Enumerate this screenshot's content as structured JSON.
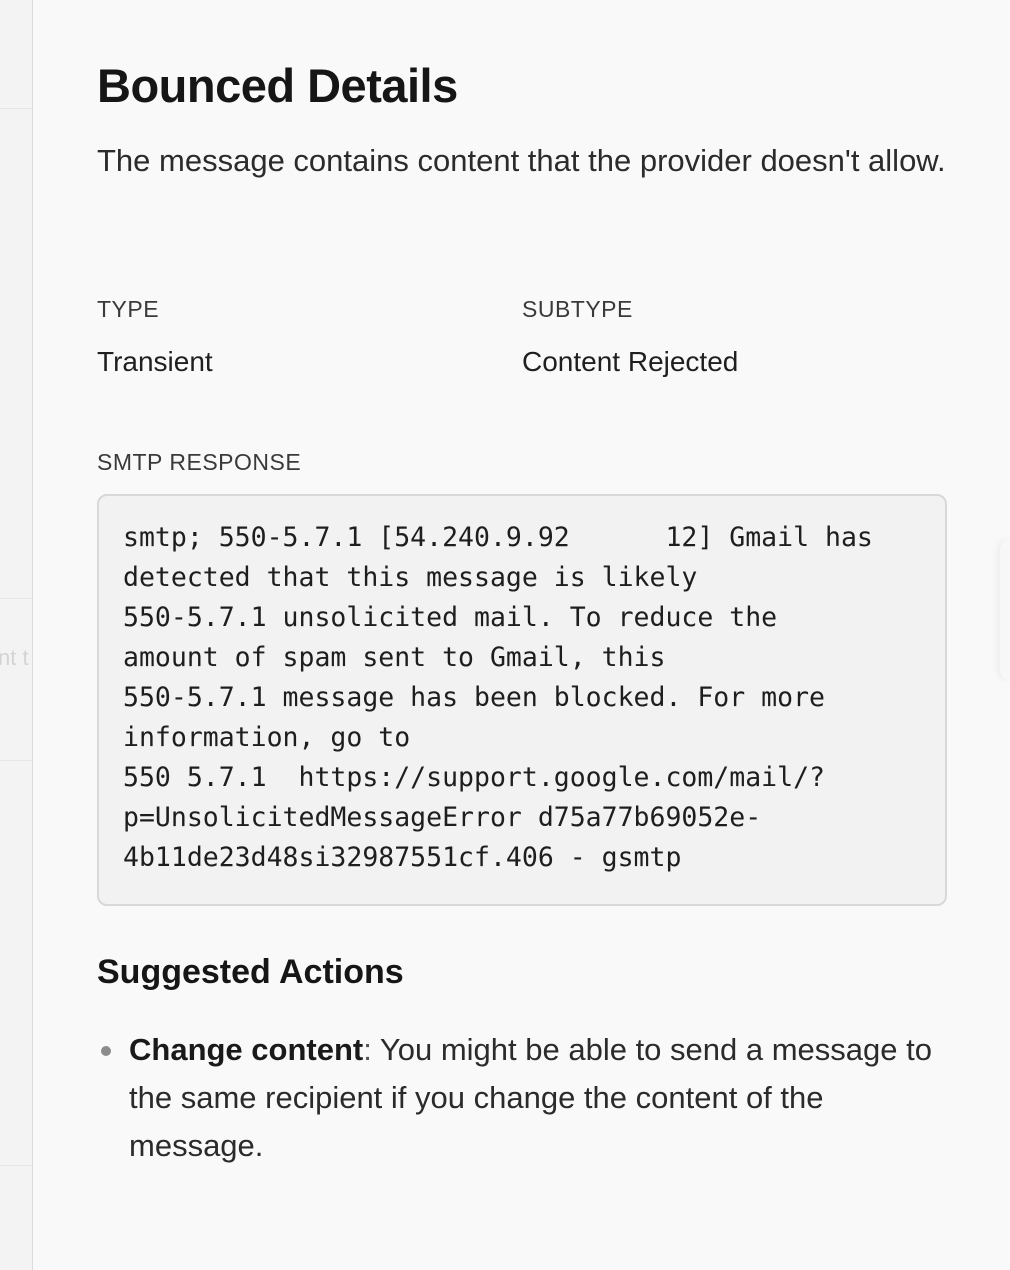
{
  "panel": {
    "title": "Bounced Details",
    "description": "The message contains content that the provider doesn't allow."
  },
  "fields": {
    "type_label": "TYPE",
    "type_value": "Transient",
    "subtype_label": "SUBTYPE",
    "subtype_value": "Content Rejected"
  },
  "smtp": {
    "label": "SMTP RESPONSE",
    "response": "smtp; 550-5.7.1 [54.240.9.92      12] Gmail has\ndetected that this message is likely\n550-5.7.1 unsolicited mail. To reduce the\namount of spam sent to Gmail, this\n550-5.7.1 message has been blocked. For more\ninformation, go to\n550 5.7.1  https://support.google.com/mail/?\np=UnsolicitedMessageError d75a77b69052e-\n4b11de23d48si32987551cf.406 - gsmtp"
  },
  "suggested_actions": {
    "heading": "Suggested Actions",
    "items": [
      {
        "title": "Change content",
        "separator": ":",
        "text": " You might be able to send a message to the same recipient if you change the content of the message."
      }
    ]
  },
  "background": {
    "faded_text": "nt t"
  }
}
